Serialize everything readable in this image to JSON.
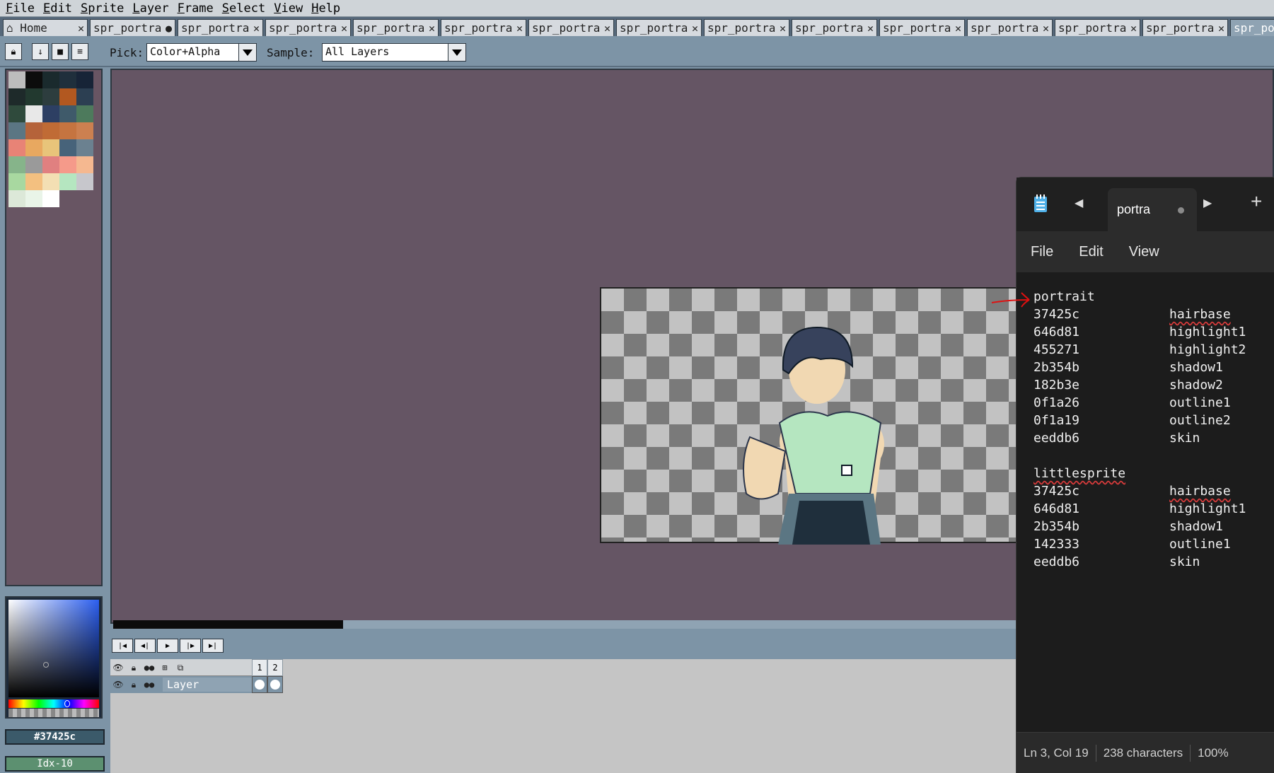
{
  "menubar": [
    "File",
    "Edit",
    "Sprite",
    "Layer",
    "Frame",
    "Select",
    "View",
    "Help"
  ],
  "tabs": {
    "home": "Home",
    "sprite_tab_label": "spr_portra",
    "active_label": "spr_po",
    "close_glyph": "✕",
    "modified_glyph": "●"
  },
  "toolbar": {
    "pick_label": "Pick:",
    "pick_value": "Color+Alpha",
    "sample_label": "Sample:",
    "sample_value": "All Layers"
  },
  "palette": [
    "#bdbdbd",
    "#0c0c0c",
    "#1a2a2d",
    "#1f2f3c",
    "#172437",
    "#1e2a2a",
    "#22392f",
    "#2d3d3e",
    "#b25820",
    "#2c3f52",
    "#2f4a3c",
    "#e8e8e8",
    "#2d3f63",
    "#3f5a6a",
    "#4d7a5c",
    "#5b7683",
    "#b5633a",
    "#c06b35",
    "#c57440",
    "#cc8050",
    "#e88376",
    "#e8a860",
    "#e8c47a",
    "#47637a",
    "#6b8190",
    "#86b48a",
    "#9a9a9a",
    "#e08080",
    "#f59a8a",
    "#f5b890",
    "#a8d8a0",
    "#f3c080",
    "#f3dfb3",
    "#b5e6c0",
    "#c7c7cc",
    "#dce8d8",
    "#e9f4e8",
    "#ffffff"
  ],
  "color_hex": "#37425c",
  "color_idx": "Idx-10",
  "timeline": {
    "layer_name": "Layer",
    "frames": [
      "1",
      "2"
    ]
  },
  "notepad": {
    "tab_title": "portra",
    "menu": [
      "File",
      "Edit",
      "View"
    ],
    "lines": [
      {
        "hex": "portrait",
        "name": "",
        "squig_hex": false,
        "squig_name": false
      },
      {
        "hex": "37425c",
        "name": "hairbase",
        "squig_hex": false,
        "squig_name": true
      },
      {
        "hex": "646d81",
        "name": "highlight1",
        "squig_hex": false,
        "squig_name": false
      },
      {
        "hex": "455271",
        "name": "highlight2",
        "squig_hex": false,
        "squig_name": false
      },
      {
        "hex": "2b354b",
        "name": "shadow1",
        "squig_hex": false,
        "squig_name": false
      },
      {
        "hex": "182b3e",
        "name": "shadow2",
        "squig_hex": false,
        "squig_name": false
      },
      {
        "hex": "0f1a26",
        "name": "outline1",
        "squig_hex": false,
        "squig_name": false
      },
      {
        "hex": "0f1a19",
        "name": "outline2",
        "squig_hex": false,
        "squig_name": false
      },
      {
        "hex": "eeddb6",
        "name": "skin",
        "squig_hex": false,
        "squig_name": false
      },
      {
        "hex": "",
        "name": "",
        "squig_hex": false,
        "squig_name": false
      },
      {
        "hex": "littlesprite",
        "name": "",
        "squig_hex": true,
        "squig_name": false
      },
      {
        "hex": "37425c",
        "name": "hairbase",
        "squig_hex": false,
        "squig_name": true
      },
      {
        "hex": "646d81",
        "name": "highlight1",
        "squig_hex": false,
        "squig_name": false
      },
      {
        "hex": "2b354b",
        "name": "shadow1",
        "squig_hex": false,
        "squig_name": false
      },
      {
        "hex": "142333",
        "name": "outline1",
        "squig_hex": false,
        "squig_name": false
      },
      {
        "hex": "eeddb6",
        "name": "skin",
        "squig_hex": false,
        "squig_name": false
      }
    ],
    "status": {
      "position": "Ln 3, Col 19",
      "chars": "238 characters",
      "zoom": "100%"
    }
  }
}
